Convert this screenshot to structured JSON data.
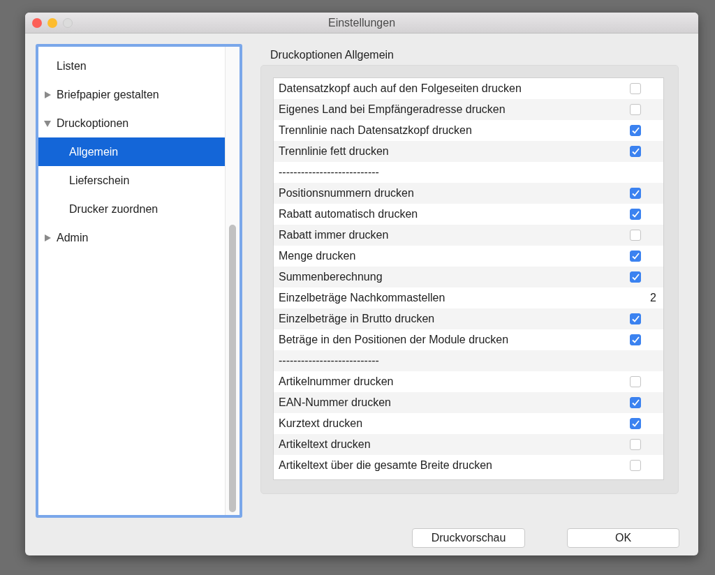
{
  "window": {
    "title": "Einstellungen"
  },
  "sidebar": {
    "items": [
      {
        "label": "Listen",
        "kind": "leaf",
        "selected": false
      },
      {
        "label": "Briefpapier gestalten",
        "kind": "folder",
        "expanded": false,
        "selected": false
      },
      {
        "label": "Druckoptionen",
        "kind": "folder",
        "expanded": true,
        "selected": false,
        "children": [
          {
            "label": "Allgemein",
            "kind": "leaf",
            "selected": true
          },
          {
            "label": "Lieferschein",
            "kind": "leaf",
            "selected": false
          },
          {
            "label": "Drucker zuordnen",
            "kind": "leaf",
            "selected": false
          }
        ]
      },
      {
        "label": "Admin",
        "kind": "folder",
        "expanded": false,
        "selected": false
      }
    ]
  },
  "section_title": "Druckoptionen Allgemein",
  "options": [
    {
      "kind": "checkbox",
      "label": "Datensatzkopf auch auf den Folgeseiten drucken",
      "checked": false
    },
    {
      "kind": "checkbox",
      "label": "Eigenes Land bei Empfängeradresse drucken",
      "checked": false
    },
    {
      "kind": "checkbox",
      "label": "Trennlinie nach Datensatzkopf drucken",
      "checked": true
    },
    {
      "kind": "checkbox",
      "label": "Trennlinie fett drucken",
      "checked": true
    },
    {
      "kind": "separator",
      "label": "---------------------------"
    },
    {
      "kind": "checkbox",
      "label": "Positionsnummern drucken",
      "checked": true
    },
    {
      "kind": "checkbox",
      "label": "Rabatt automatisch drucken",
      "checked": true
    },
    {
      "kind": "checkbox",
      "label": "Rabatt immer drucken",
      "checked": false
    },
    {
      "kind": "checkbox",
      "label": "Menge drucken",
      "checked": true
    },
    {
      "kind": "checkbox",
      "label": "Summenberechnung",
      "checked": true
    },
    {
      "kind": "number",
      "label": "Einzelbeträge Nachkommastellen",
      "value": "2"
    },
    {
      "kind": "checkbox",
      "label": "Einzelbeträge in Brutto drucken",
      "checked": true
    },
    {
      "kind": "checkbox",
      "label": "Beträge in den Positionen der Module drucken",
      "checked": true
    },
    {
      "kind": "separator",
      "label": "---------------------------"
    },
    {
      "kind": "checkbox",
      "label": "Artikelnummer drucken",
      "checked": false
    },
    {
      "kind": "checkbox",
      "label": "EAN-Nummer drucken",
      "checked": true
    },
    {
      "kind": "checkbox",
      "label": "Kurztext drucken",
      "checked": true
    },
    {
      "kind": "checkbox",
      "label": "Artikeltext drucken",
      "checked": false
    },
    {
      "kind": "checkbox",
      "label": "Artikeltext über die gesamte Breite drucken",
      "checked": false
    }
  ],
  "buttons": [
    {
      "label": "Druckvorschau"
    },
    {
      "label": "OK"
    }
  ]
}
